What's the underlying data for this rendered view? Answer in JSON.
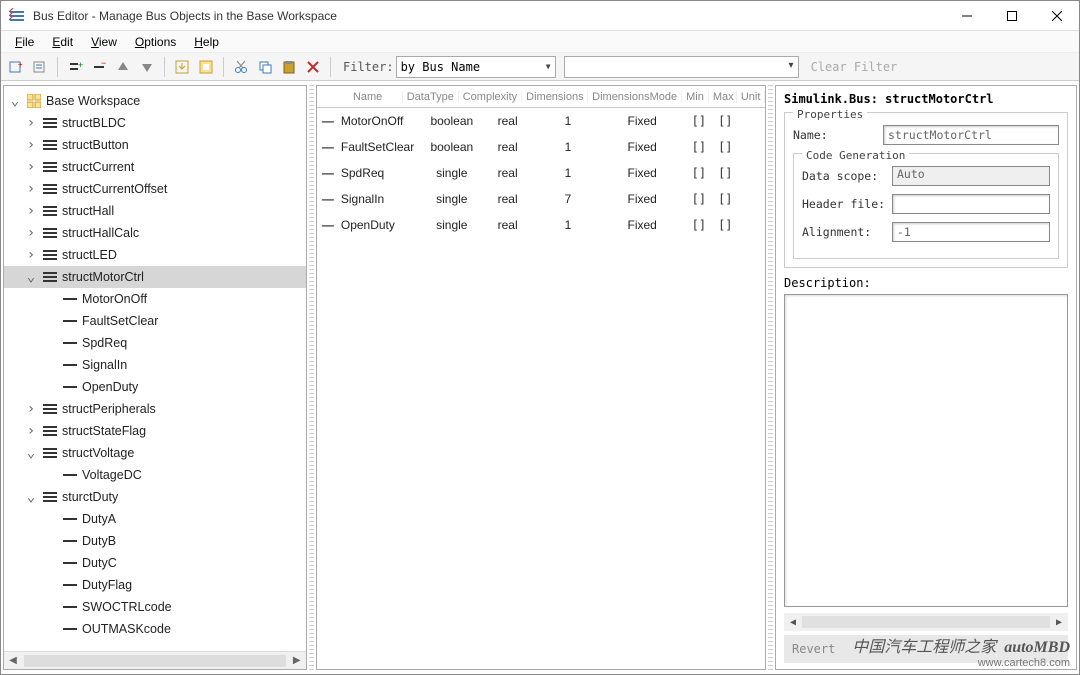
{
  "window": {
    "title": "Bus Editor - Manage Bus Objects in the Base Workspace"
  },
  "menu": {
    "file": "File",
    "edit": "Edit",
    "view": "View",
    "options": "Options",
    "help": "Help"
  },
  "toolbar": {
    "filter_label": "Filter:",
    "filter_mode": "by Bus Name",
    "filter_value": "",
    "clear": "Clear Filter"
  },
  "tree": {
    "root": "Base Workspace",
    "items": [
      {
        "label": "structBLDC",
        "expanded": false,
        "children": []
      },
      {
        "label": "structButton",
        "expanded": false,
        "children": []
      },
      {
        "label": "structCurrent",
        "expanded": false,
        "children": []
      },
      {
        "label": "structCurrentOffset",
        "expanded": false,
        "children": []
      },
      {
        "label": "structHall",
        "expanded": false,
        "children": []
      },
      {
        "label": "structHallCalc",
        "expanded": false,
        "children": []
      },
      {
        "label": "structLED",
        "expanded": false,
        "children": []
      },
      {
        "label": "structMotorCtrl",
        "expanded": true,
        "selected": true,
        "children": [
          "MotorOnOff",
          "FaultSetClear",
          "SpdReq",
          "SignalIn",
          "OpenDuty"
        ]
      },
      {
        "label": "structPeripherals",
        "expanded": false,
        "children": []
      },
      {
        "label": "structStateFlag",
        "expanded": false,
        "children": []
      },
      {
        "label": "structVoltage",
        "expanded": true,
        "children": [
          "VoltageDC"
        ]
      },
      {
        "label": "sturctDuty",
        "expanded": true,
        "children": [
          "DutyA",
          "DutyB",
          "DutyC",
          "DutyFlag",
          "SWOCTRLcode",
          "OUTMASKcode"
        ]
      }
    ]
  },
  "table": {
    "headers": {
      "name": "Name",
      "datatype": "DataType",
      "complexity": "Complexity",
      "dimensions": "Dimensions",
      "dimmode": "DimensionsMode",
      "min": "Min",
      "max": "Max",
      "unit": "Unit"
    },
    "rows": [
      {
        "name": "MotorOnOff",
        "datatype": "boolean",
        "complexity": "real",
        "dimensions": "1",
        "dimmode": "Fixed",
        "min": "[]",
        "max": "[]",
        "unit": ""
      },
      {
        "name": "FaultSetClear",
        "datatype": "boolean",
        "complexity": "real",
        "dimensions": "1",
        "dimmode": "Fixed",
        "min": "[]",
        "max": "[]",
        "unit": ""
      },
      {
        "name": "SpdReq",
        "datatype": "single",
        "complexity": "real",
        "dimensions": "1",
        "dimmode": "Fixed",
        "min": "[]",
        "max": "[]",
        "unit": ""
      },
      {
        "name": "SignalIn",
        "datatype": "single",
        "complexity": "real",
        "dimensions": "7",
        "dimmode": "Fixed",
        "min": "[]",
        "max": "[]",
        "unit": ""
      },
      {
        "name": "OpenDuty",
        "datatype": "single",
        "complexity": "real",
        "dimensions": "1",
        "dimmode": "Fixed",
        "min": "[]",
        "max": "[]",
        "unit": ""
      }
    ]
  },
  "props": {
    "title": "Simulink.Bus: structMotorCtrl",
    "group1": "Properties",
    "name_label": "Name:",
    "name_value": "structMotorCtrl",
    "group2": "Code Generation",
    "scope_label": "Data scope:",
    "scope_value": "Auto",
    "header_label": "Header file:",
    "header_value": "",
    "align_label": "Alignment:",
    "align_value": "-1",
    "desc_label": "Description:",
    "revert": "Revert"
  },
  "watermark": {
    "line1": "中国汽车工程师之家",
    "brand": "autoMBD",
    "url": "www.cartech8.com"
  }
}
